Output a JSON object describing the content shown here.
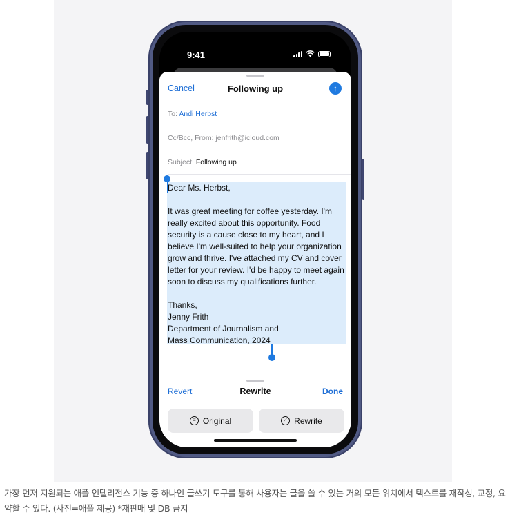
{
  "status": {
    "time": "9:41"
  },
  "mail": {
    "cancel_label": "Cancel",
    "title": "Following up",
    "to_label": "To:",
    "to_value": "Andi Herbst",
    "cc_label": "Cc/Bcc, From:",
    "cc_value": "jenfrith@icloud.com",
    "subject_label": "Subject:",
    "subject_value": "Following up",
    "body": "Dear Ms. Herbst,\n\nIt was great meeting for coffee yesterday. I'm really excited about this opportunity. Food security is a cause close to my heart, and I believe I'm well-suited to help your organization grow and thrive. I've attached my CV and cover letter for your review. I'd be happy to meet again soon to discuss my qualifications further.\n\nThanks,\nJenny Frith\nDepartment of Journalism and\nMass Communication, 2024"
  },
  "writing_tools": {
    "revert_label": "Revert",
    "title": "Rewrite",
    "done_label": "Done",
    "original_label": "Original",
    "rewrite_label": "Rewrite"
  },
  "caption": "가장 먼저 지원되는 애플 인텔리전스 기능 중 하나인 글쓰기 도구를 통해 사용자는 글을 쓸 수 있는 거의 모든 위치에서 텍스트를 재작성, 교정, 요약할 수 있다. (사진=애플 제공) *재판매 및 DB 금지",
  "colors": {
    "accent": "#1f7ae0",
    "selection": "#dcecfb",
    "phone_frame": "#515a84"
  }
}
